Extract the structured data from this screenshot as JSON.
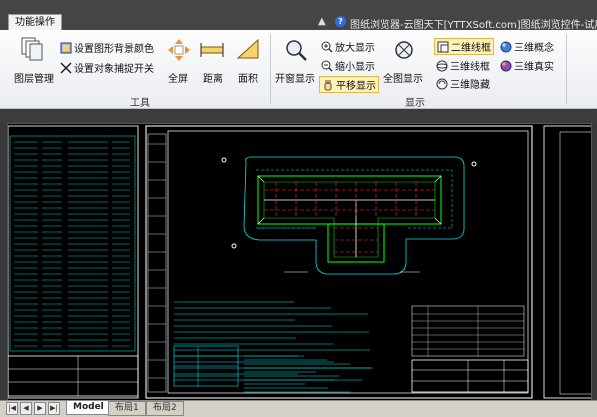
{
  "titlebar": {
    "tab_label": "功能操作",
    "window_title": "图纸浏览器-云图天下[YTTXSoft.com]图纸浏览控件-试用版",
    "minimize_symbol": "▲",
    "help_symbol": "?"
  },
  "ribbon": {
    "tools_group": {
      "label": "工具",
      "layer_mgr": "图层管理",
      "set_bg": "设置图形背景颜色",
      "set_snap": "设置对象捕捉开关",
      "fullscreen": "全屏",
      "distance": "距离",
      "area": "面积"
    },
    "display_group": {
      "label": "显示",
      "window_display": "开窗显示",
      "zoom_in": "放大显示",
      "zoom_out": "缩小显示",
      "pan": "平移显示",
      "full_display": "全图显示",
      "wire2d": "二维线框",
      "wire3d": "三维线框",
      "hidden3d": "三维隐藏",
      "concept3d": "三维概念",
      "real3d": "三维真实"
    }
  },
  "layout_tabs": {
    "nav_first": "|◀",
    "nav_prev": "◀",
    "nav_next": "▶",
    "nav_last": "▶|",
    "model": "Model",
    "layout1": "布局1",
    "layout2": "布局2"
  },
  "colors": {
    "cad_bg": "#000000",
    "cad_green": "#00e000",
    "cad_cyan": "#00e6e6",
    "cad_red": "#ff3030",
    "cad_white": "#ffffff",
    "ribbon_bg": "#f1f3f6",
    "selected": "#fff2b8"
  }
}
